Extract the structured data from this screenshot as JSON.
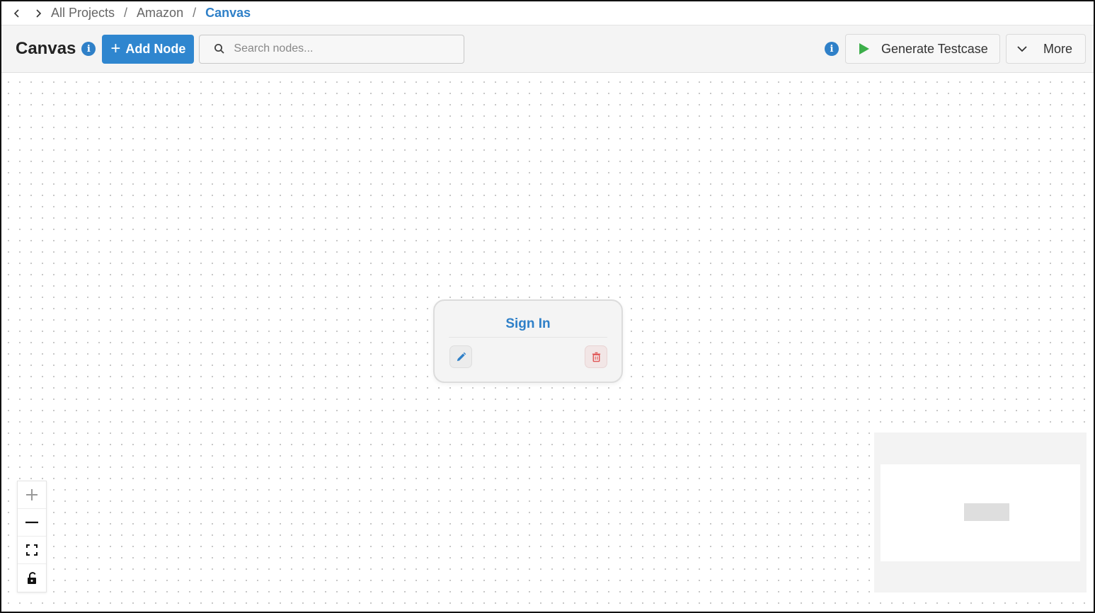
{
  "breadcrumb": {
    "items": [
      "All Projects",
      "Amazon",
      "Canvas"
    ],
    "separator": "/"
  },
  "toolbar": {
    "title": "Canvas",
    "add_node_label": "Add Node",
    "search_placeholder": "Search nodes...",
    "generate_label": "Generate Testcase",
    "more_label": "More"
  },
  "canvas": {
    "nodes": [
      {
        "title": "Sign In"
      }
    ]
  },
  "colors": {
    "accent": "#2f86cf",
    "play": "#3cae4a",
    "delete": "#e05555"
  },
  "icons": {
    "back": "chevron-left-icon",
    "forward": "chevron-right-icon",
    "info": "info-icon",
    "search": "search-icon",
    "play": "play-icon",
    "more": "chevron-down-icon",
    "edit": "pencil-icon",
    "delete": "trash-icon",
    "zoom_in": "plus-icon",
    "zoom_out": "minus-icon",
    "fit": "fit-view-icon",
    "lock": "unlock-icon"
  }
}
